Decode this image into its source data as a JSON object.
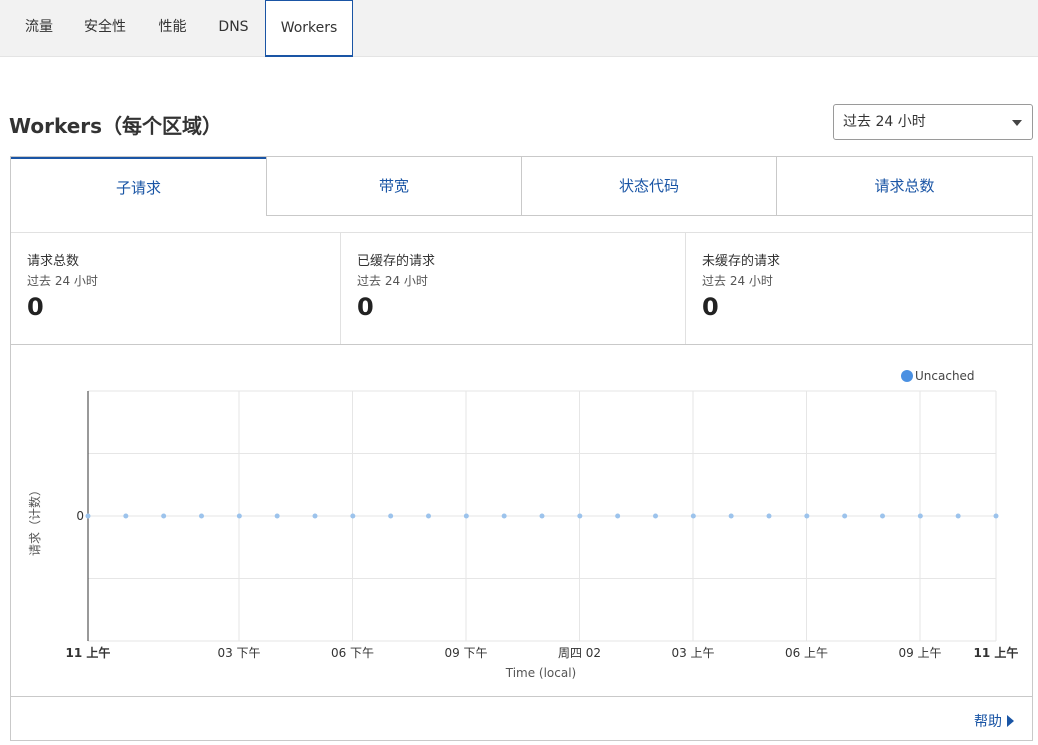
{
  "topnav": {
    "tabs": [
      {
        "label": "流量"
      },
      {
        "label": "安全性"
      },
      {
        "label": "性能"
      },
      {
        "label": "DNS"
      },
      {
        "label": "Workers"
      }
    ]
  },
  "page": {
    "title": "Workers（每个区域）"
  },
  "time_select": {
    "value": "过去 24 小时"
  },
  "subtabs": [
    {
      "label": "子请求"
    },
    {
      "label": "带宽"
    },
    {
      "label": "状态代码"
    },
    {
      "label": "请求总数"
    }
  ],
  "stats": [
    {
      "label": "请求总数",
      "period": "过去 24 小时",
      "value": "0"
    },
    {
      "label": "已缓存的请求",
      "period": "过去 24 小时",
      "value": "0"
    },
    {
      "label": "未缓存的请求",
      "period": "过去 24 小时",
      "value": "0"
    }
  ],
  "help": {
    "label": "帮助"
  },
  "chart_data": {
    "type": "line",
    "title": "",
    "xlabel": "Time (local)",
    "ylabel": "请求（计数）",
    "y_ticks": [
      "0"
    ],
    "x_ticks": [
      "11 上午",
      "03 下午",
      "06 下午",
      "09 下午",
      "周四 02",
      "03 上午",
      "06 上午",
      "09 上午",
      "11 上午"
    ],
    "bold_x_ticks": [
      "11 上午"
    ],
    "legend_position": "top-right",
    "grid": true,
    "series": [
      {
        "name": "Uncached",
        "color": "#4a90e2",
        "values": [
          0,
          0,
          0,
          0,
          0,
          0,
          0,
          0,
          0,
          0,
          0,
          0,
          0,
          0,
          0,
          0,
          0,
          0,
          0,
          0,
          0,
          0,
          0,
          0,
          0
        ]
      }
    ]
  }
}
